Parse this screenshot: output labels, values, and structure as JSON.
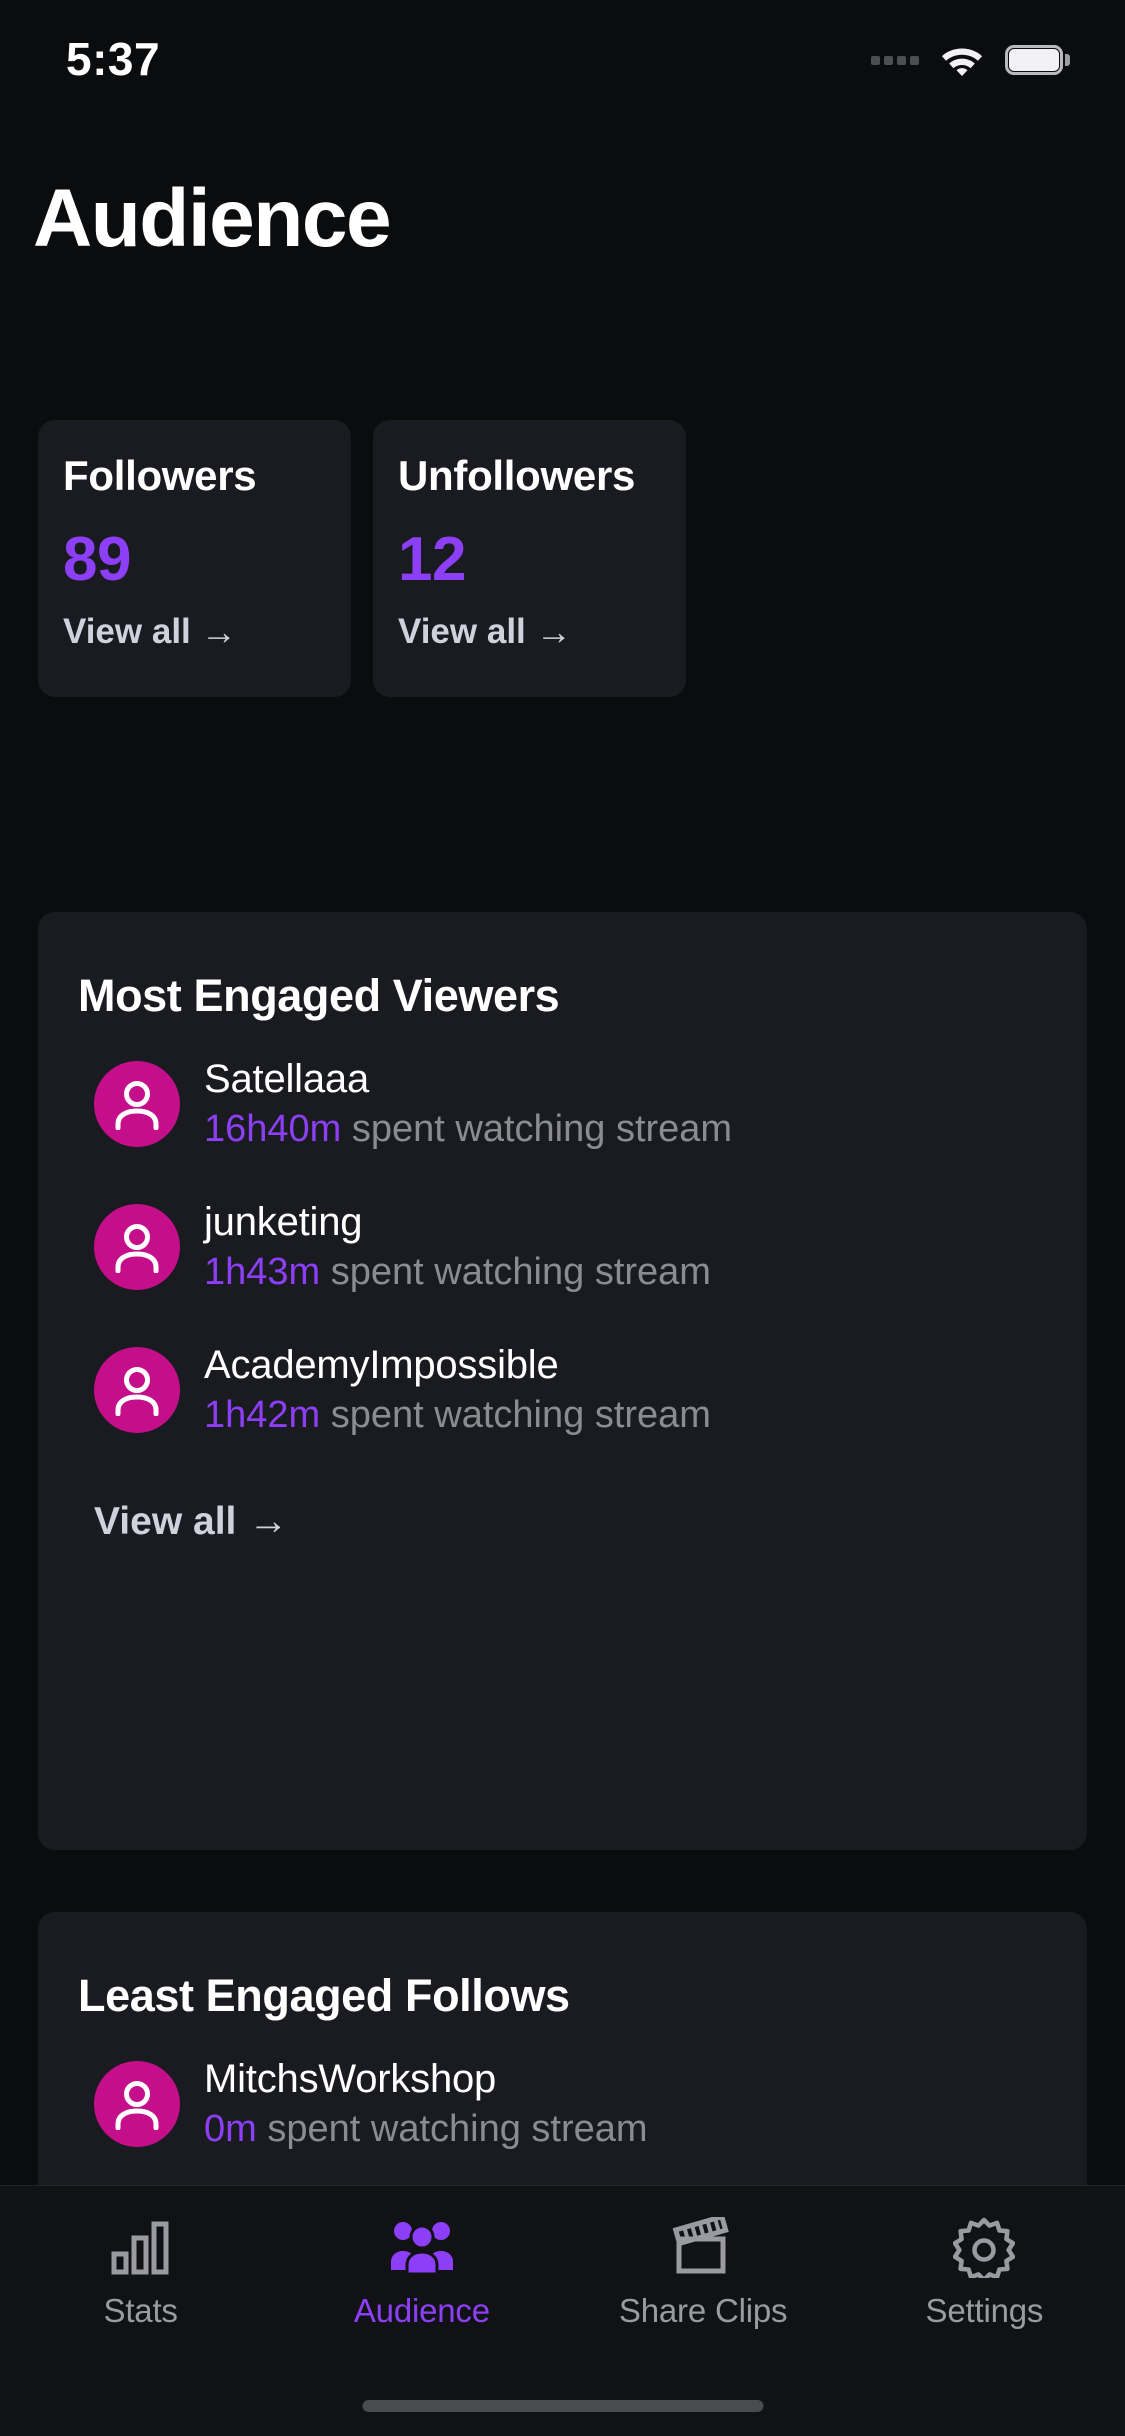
{
  "status_bar": {
    "time": "5:37",
    "cellular_icon": "cellular-dots-icon",
    "wifi_icon": "wifi-icon",
    "battery_icon": "battery-full-icon"
  },
  "page": {
    "title": "Audience"
  },
  "stats": [
    {
      "label": "Followers",
      "value": "89",
      "link": "View all",
      "arrow": "→"
    },
    {
      "label": "Unfollowers",
      "value": "12",
      "link": "View all",
      "arrow": "→"
    }
  ],
  "most_engaged": {
    "title": "Most Engaged Viewers",
    "viewers": [
      {
        "name": "Satellaaa",
        "duration": "16h40m",
        "suffix": " spent watching stream"
      },
      {
        "name": "junketing",
        "duration": "1h43m",
        "suffix": " spent watching stream"
      },
      {
        "name": "AcademyImpossible",
        "duration": "1h42m",
        "suffix": " spent watching stream"
      }
    ],
    "link": "View all",
    "arrow": "→"
  },
  "least_engaged": {
    "title": "Least Engaged Follows",
    "viewers": [
      {
        "name": "MitchsWorkshop",
        "duration": "0m",
        "suffix": " spent watching stream"
      }
    ]
  },
  "tabs": [
    {
      "label": "Stats",
      "icon": "bar-chart-icon",
      "active": false
    },
    {
      "label": "Audience",
      "icon": "people-icon",
      "active": true
    },
    {
      "label": "Share Clips",
      "icon": "clapperboard-icon",
      "active": false
    },
    {
      "label": "Settings",
      "icon": "gear-icon",
      "active": false
    }
  ],
  "colors": {
    "background": "#0B0C0E",
    "card": "#1A1B20",
    "accent_purple": "#8C3FF6",
    "avatar_magenta": "#C40E8A",
    "muted_text": "#8B8C90",
    "link_text": "#CFD1DC"
  }
}
